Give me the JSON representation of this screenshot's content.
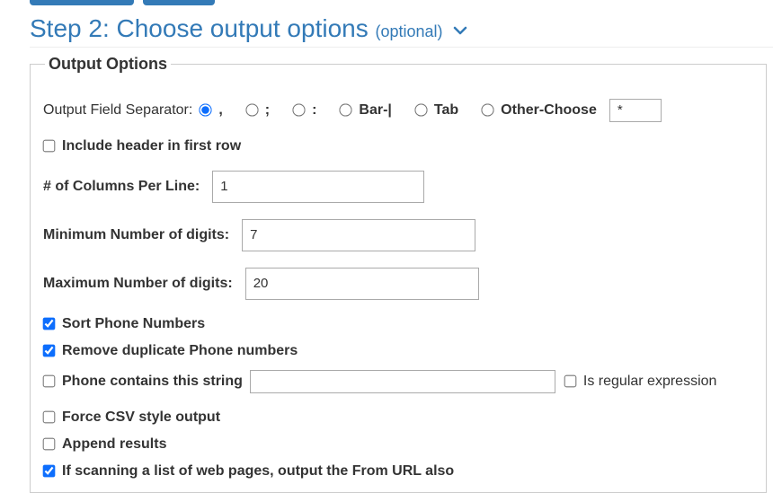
{
  "step": {
    "prefix": "Step 2: Choose output options",
    "optional": "(optional)"
  },
  "legend": "Output Options",
  "sep": {
    "label": "Output Field Separator:",
    "comma": ",",
    "semi": ";",
    "colon": ":",
    "bar": "Bar-|",
    "tab": "Tab",
    "other": "Other-Choose",
    "other_value": "*",
    "selected": "comma"
  },
  "includeHeader": {
    "label": "Include header in first row",
    "checked": false
  },
  "cols": {
    "label": "# of Columns Per Line:",
    "value": "1"
  },
  "minDigits": {
    "label": "Minimum Number of digits:",
    "value": "7"
  },
  "maxDigits": {
    "label": "Maximum Number of digits:",
    "value": "20"
  },
  "sortPhones": {
    "label": "Sort Phone Numbers",
    "checked": true
  },
  "removeDup": {
    "label": "Remove duplicate Phone numbers",
    "checked": true
  },
  "contains": {
    "label": "Phone contains this string",
    "checked": false,
    "value": ""
  },
  "isRegex": {
    "label": "Is regular expression",
    "checked": false
  },
  "forceCsv": {
    "label": "Force CSV style output",
    "checked": false
  },
  "append": {
    "label": "Append results",
    "checked": false
  },
  "fromUrl": {
    "label": "If scanning a list of web pages, output the From URL also",
    "checked": true
  }
}
